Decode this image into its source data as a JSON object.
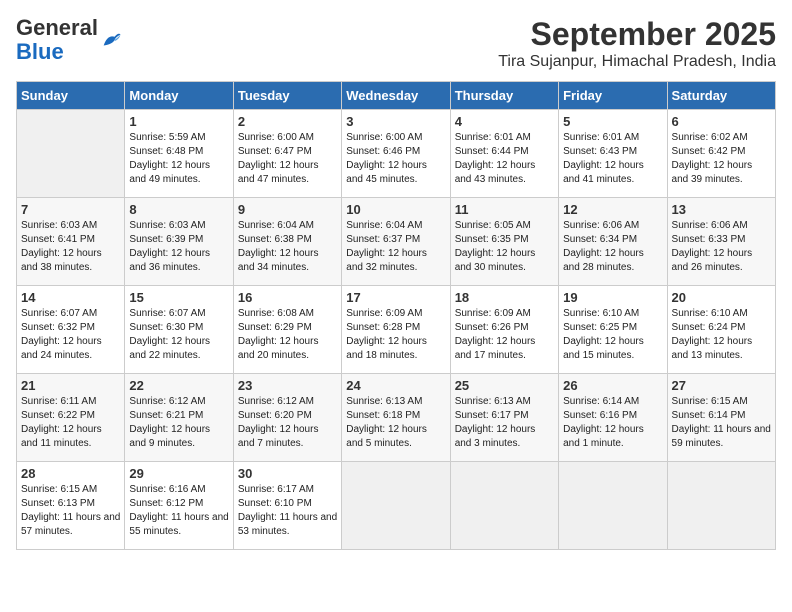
{
  "header": {
    "logo_general": "General",
    "logo_blue": "Blue",
    "month_title": "September 2025",
    "location": "Tira Sujanpur, Himachal Pradesh, India"
  },
  "weekdays": [
    "Sunday",
    "Monday",
    "Tuesday",
    "Wednesday",
    "Thursday",
    "Friday",
    "Saturday"
  ],
  "weeks": [
    [
      {
        "day": "",
        "sunrise": "",
        "sunset": "",
        "daylight": ""
      },
      {
        "day": "1",
        "sunrise": "Sunrise: 5:59 AM",
        "sunset": "Sunset: 6:48 PM",
        "daylight": "Daylight: 12 hours and 49 minutes."
      },
      {
        "day": "2",
        "sunrise": "Sunrise: 6:00 AM",
        "sunset": "Sunset: 6:47 PM",
        "daylight": "Daylight: 12 hours and 47 minutes."
      },
      {
        "day": "3",
        "sunrise": "Sunrise: 6:00 AM",
        "sunset": "Sunset: 6:46 PM",
        "daylight": "Daylight: 12 hours and 45 minutes."
      },
      {
        "day": "4",
        "sunrise": "Sunrise: 6:01 AM",
        "sunset": "Sunset: 6:44 PM",
        "daylight": "Daylight: 12 hours and 43 minutes."
      },
      {
        "day": "5",
        "sunrise": "Sunrise: 6:01 AM",
        "sunset": "Sunset: 6:43 PM",
        "daylight": "Daylight: 12 hours and 41 minutes."
      },
      {
        "day": "6",
        "sunrise": "Sunrise: 6:02 AM",
        "sunset": "Sunset: 6:42 PM",
        "daylight": "Daylight: 12 hours and 39 minutes."
      }
    ],
    [
      {
        "day": "7",
        "sunrise": "Sunrise: 6:03 AM",
        "sunset": "Sunset: 6:41 PM",
        "daylight": "Daylight: 12 hours and 38 minutes."
      },
      {
        "day": "8",
        "sunrise": "Sunrise: 6:03 AM",
        "sunset": "Sunset: 6:39 PM",
        "daylight": "Daylight: 12 hours and 36 minutes."
      },
      {
        "day": "9",
        "sunrise": "Sunrise: 6:04 AM",
        "sunset": "Sunset: 6:38 PM",
        "daylight": "Daylight: 12 hours and 34 minutes."
      },
      {
        "day": "10",
        "sunrise": "Sunrise: 6:04 AM",
        "sunset": "Sunset: 6:37 PM",
        "daylight": "Daylight: 12 hours and 32 minutes."
      },
      {
        "day": "11",
        "sunrise": "Sunrise: 6:05 AM",
        "sunset": "Sunset: 6:35 PM",
        "daylight": "Daylight: 12 hours and 30 minutes."
      },
      {
        "day": "12",
        "sunrise": "Sunrise: 6:06 AM",
        "sunset": "Sunset: 6:34 PM",
        "daylight": "Daylight: 12 hours and 28 minutes."
      },
      {
        "day": "13",
        "sunrise": "Sunrise: 6:06 AM",
        "sunset": "Sunset: 6:33 PM",
        "daylight": "Daylight: 12 hours and 26 minutes."
      }
    ],
    [
      {
        "day": "14",
        "sunrise": "Sunrise: 6:07 AM",
        "sunset": "Sunset: 6:32 PM",
        "daylight": "Daylight: 12 hours and 24 minutes."
      },
      {
        "day": "15",
        "sunrise": "Sunrise: 6:07 AM",
        "sunset": "Sunset: 6:30 PM",
        "daylight": "Daylight: 12 hours and 22 minutes."
      },
      {
        "day": "16",
        "sunrise": "Sunrise: 6:08 AM",
        "sunset": "Sunset: 6:29 PM",
        "daylight": "Daylight: 12 hours and 20 minutes."
      },
      {
        "day": "17",
        "sunrise": "Sunrise: 6:09 AM",
        "sunset": "Sunset: 6:28 PM",
        "daylight": "Daylight: 12 hours and 18 minutes."
      },
      {
        "day": "18",
        "sunrise": "Sunrise: 6:09 AM",
        "sunset": "Sunset: 6:26 PM",
        "daylight": "Daylight: 12 hours and 17 minutes."
      },
      {
        "day": "19",
        "sunrise": "Sunrise: 6:10 AM",
        "sunset": "Sunset: 6:25 PM",
        "daylight": "Daylight: 12 hours and 15 minutes."
      },
      {
        "day": "20",
        "sunrise": "Sunrise: 6:10 AM",
        "sunset": "Sunset: 6:24 PM",
        "daylight": "Daylight: 12 hours and 13 minutes."
      }
    ],
    [
      {
        "day": "21",
        "sunrise": "Sunrise: 6:11 AM",
        "sunset": "Sunset: 6:22 PM",
        "daylight": "Daylight: 12 hours and 11 minutes."
      },
      {
        "day": "22",
        "sunrise": "Sunrise: 6:12 AM",
        "sunset": "Sunset: 6:21 PM",
        "daylight": "Daylight: 12 hours and 9 minutes."
      },
      {
        "day": "23",
        "sunrise": "Sunrise: 6:12 AM",
        "sunset": "Sunset: 6:20 PM",
        "daylight": "Daylight: 12 hours and 7 minutes."
      },
      {
        "day": "24",
        "sunrise": "Sunrise: 6:13 AM",
        "sunset": "Sunset: 6:18 PM",
        "daylight": "Daylight: 12 hours and 5 minutes."
      },
      {
        "day": "25",
        "sunrise": "Sunrise: 6:13 AM",
        "sunset": "Sunset: 6:17 PM",
        "daylight": "Daylight: 12 hours and 3 minutes."
      },
      {
        "day": "26",
        "sunrise": "Sunrise: 6:14 AM",
        "sunset": "Sunset: 6:16 PM",
        "daylight": "Daylight: 12 hours and 1 minute."
      },
      {
        "day": "27",
        "sunrise": "Sunrise: 6:15 AM",
        "sunset": "Sunset: 6:14 PM",
        "daylight": "Daylight: 11 hours and 59 minutes."
      }
    ],
    [
      {
        "day": "28",
        "sunrise": "Sunrise: 6:15 AM",
        "sunset": "Sunset: 6:13 PM",
        "daylight": "Daylight: 11 hours and 57 minutes."
      },
      {
        "day": "29",
        "sunrise": "Sunrise: 6:16 AM",
        "sunset": "Sunset: 6:12 PM",
        "daylight": "Daylight: 11 hours and 55 minutes."
      },
      {
        "day": "30",
        "sunrise": "Sunrise: 6:17 AM",
        "sunset": "Sunset: 6:10 PM",
        "daylight": "Daylight: 11 hours and 53 minutes."
      },
      {
        "day": "",
        "sunrise": "",
        "sunset": "",
        "daylight": ""
      },
      {
        "day": "",
        "sunrise": "",
        "sunset": "",
        "daylight": ""
      },
      {
        "day": "",
        "sunrise": "",
        "sunset": "",
        "daylight": ""
      },
      {
        "day": "",
        "sunrise": "",
        "sunset": "",
        "daylight": ""
      }
    ]
  ]
}
